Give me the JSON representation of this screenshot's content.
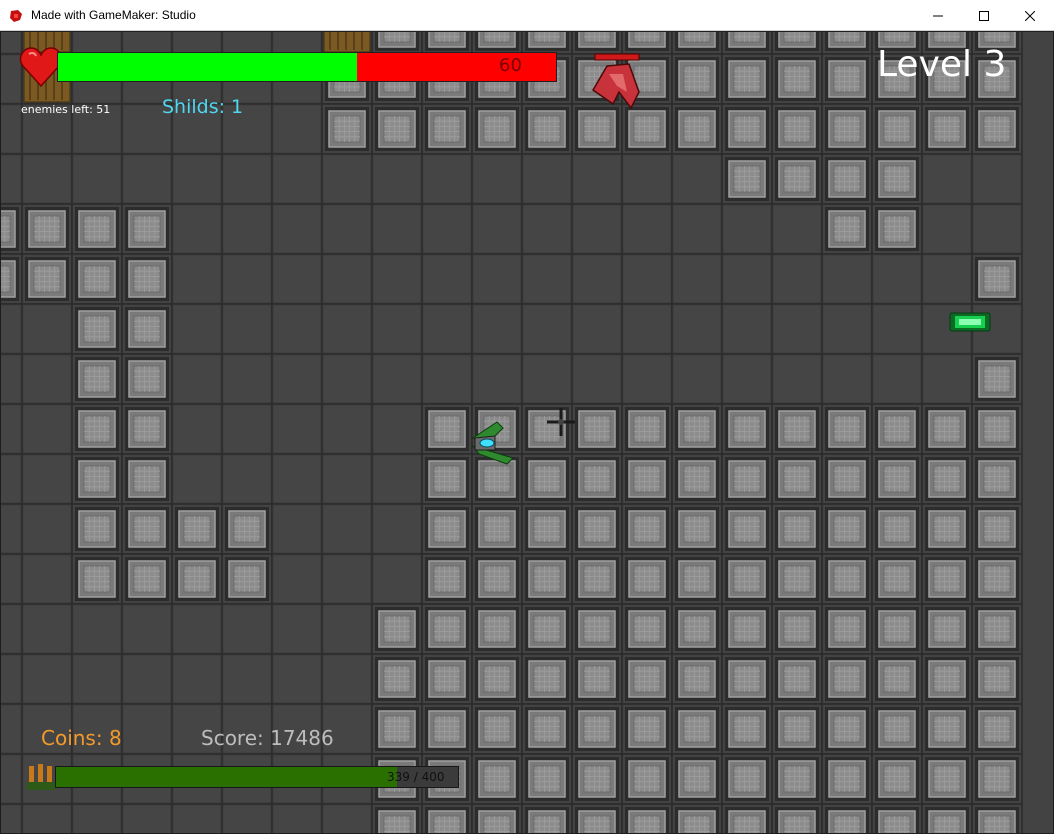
{
  "window": {
    "title": "Made with GameMaker: Studio",
    "controls": {
      "minimize": "—",
      "maximize": "☐",
      "close": "✕"
    }
  },
  "hud": {
    "level_label": "Level 3",
    "health_value": "60",
    "health_fraction": 0.6,
    "enemies_left_label": "enemies left:  51",
    "shields_label": "Shilds:   1",
    "coins_label": "Coins: 8",
    "score_label": "Score: 17486",
    "ammo_text": "339 / 400",
    "ammo_fraction": 0.8475
  },
  "colors": {
    "health_fill": "#00ff00",
    "health_empty": "#ff0000",
    "heart": "#e01818",
    "ammo_fill": "#2a7000",
    "shields_text": "#4fd8f0",
    "coins_text": "#f39a2a",
    "score_text": "#bdbdbd",
    "floor": "#434343",
    "enemy": "#c8323a",
    "player": "#2f8a2f",
    "pickup": "#18d050"
  },
  "icons": [
    "app-icon",
    "heart-icon",
    "ammo-icon",
    "crosshair-icon",
    "player-ship-icon",
    "enemy-ship-icon",
    "health-pack-icon"
  ],
  "map": {
    "cols": 21,
    "rows": 17,
    "legend": {
      ".": "floor",
      "#": "wall",
      "W": "wooden-crate",
      "B": "raised-block"
    },
    "grid": [
      ".W.....WBBBBBBBBBBBBB",
      ".W.....BBBBBBBBBBBBBB",
      ".......BBBBBBBBBBBBBB",
      "...............BBBB..",
      "BBBB.............BB..",
      "BBBB................B",
      "..BB.................",
      "..BB................B",
      "..BB.....BBBBBBBBBBBB",
      "..BB.....BBBBBBBBBBBB",
      "..BBBB...BBBBBBBBBBBB",
      "..BBBB...BBBBBBBBBBBB",
      "........BBBBBBBBBBBBB",
      "........BBBBBBBBBBBBB",
      "........BBBBBBBBBBBBB",
      "........BBBBBBBBBBBBB",
      "........BBBBBBBBBBBBB"
    ]
  }
}
